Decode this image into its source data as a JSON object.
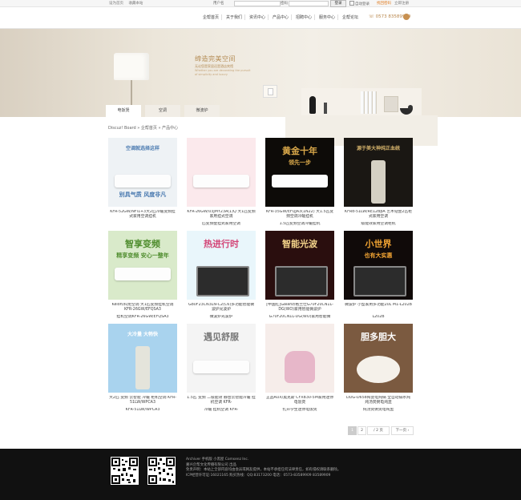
{
  "topbar": {
    "links": [
      "设为首页",
      "收藏本站"
    ],
    "username_label": "用户名",
    "login_button": "登录",
    "auto_login": "自动登录",
    "forgot_password": "找回密码",
    "register": "立即注册",
    "accent": "#e07b1f"
  },
  "nav": {
    "items": [
      "企帮首页",
      "关于我们",
      "资讯中心",
      "产品中心",
      "招聘中心",
      "服务中心",
      "企帮论坛"
    ],
    "phone": "0573 83589909"
  },
  "banner": {
    "title": "缔造完美空间",
    "subtitle": "无论您是家居还是酒店宾馆",
    "subtitle2": "Whether you are decorating the pursuit of simplicity and luxury"
  },
  "tabs": [
    "电饭煲",
    "空调",
    "微波炉"
  ],
  "breadcrumb": "Discuz! Board » 企帮首页 » 产品中心",
  "products": [
    {
      "name1": "KFR-52GW/NFI1+3大2匹冷暖变频挂式家用空调挂机",
      "name2": "",
      "img_text": "空调就选择这样",
      "img_text2": "别具气质 风度非凡",
      "bg": "#eef2f5",
      "fg": "#4a7ab0"
    },
    {
      "name1": "KFR-26GW/03JMY23A(1)Q 大1匹变频家用挂式空调",
      "name2": "匹变频壁挂式家用空调",
      "img_text": "",
      "img_text2": "",
      "bg": "#fbe9ec",
      "fg": "#e05c6a"
    },
    {
      "name1": "KFR-35GW/EFQJA3(1N22) 大1.5匹变频空调冷暖挂机",
      "name2": "1.5匹变频空调冷暖挂机",
      "img_text": "黄金十年",
      "img_text2": "领先一步",
      "bg": "#0d0b08",
      "fg": "#d9a84a"
    },
    {
      "name1": "KFRd-51LW/RE12BpA 艺术钻金2匹柜式家用空调",
      "name2": "级能效家用空调柜机",
      "img_text": "源于美大神纯正血统",
      "img_text2": "",
      "bg": "#1a1713",
      "fg": "#d6b46c"
    },
    {
      "name1": "Kelon/科龙空调 大1匹变频挂机空调 KFR-26GW/EFQSA3",
      "name2": "挂机空调KFR-26GW/EFQSA3",
      "img_text": "智享变频",
      "img_text2": "精享变频 安心一整年",
      "bg": "#d9eaca",
      "fg": "#4f8d2e"
    },
    {
      "name1": "G80F23CN3LN-C2(C6)多功能智能微波炉光波炉",
      "name2": "微波炉光波炉",
      "img_text": "热进行时",
      "img_text2": "",
      "bg": "#e9f6fb",
      "fg": "#d34476"
    },
    {
      "name1": "[中国红]Galanz/格兰仕G70F20CN1L-DG(WO)家用智能微波炉",
      "name2": "G70F20CN1L-DG(WO)家用智能微",
      "img_text": "智能光波",
      "img_text2": "",
      "bg": "#2a0e0e",
      "fg": "#f3d38a"
    },
    {
      "name1": "微波炉 小型家用多功能20L M1-L202B",
      "name2": "L202B",
      "img_text": "小世界",
      "img_text2": "也有大实惠",
      "bg": "#100a09",
      "fg": "#f2a433"
    },
    {
      "name1": "大2匹 变频 云智能 冷暖 柜机空调 KFR-51LW/WPCA3",
      "name2": "KFR-51LW/WPCA3",
      "img_text": "大冷量 大畅快",
      "img_text2": "",
      "bg": "#a9d3ee",
      "fg": "#ffffff"
    },
    {
      "name1": "1.5匹 变频 二级能效 静音云智能冷暖 挂机空调 KFR-",
      "name2": "冷暖 挂机空调 KFR-",
      "img_text": "遇见舒服",
      "img_text2": "",
      "bg": "#f4f4f4",
      "fg": "#777777"
    },
    {
      "name1": "正品AUX/奥克斯 CFXB30-5M家用迷你电饭煲",
      "name2": "扎升学生迷你电饭煲",
      "img_text": "",
      "img_text2": "",
      "bg": "#f6edea",
      "fg": "#c6618a"
    },
    {
      "name1": "DDG-D658陶瓷电炖锅 全自动隔水炖 炖汤煲粥电炖盅",
      "name2": "炖汤煲粥煲电炖盅",
      "img_text": "胆多胆大",
      "img_text2": "",
      "bg": "#7b5a40",
      "fg": "#ffffff"
    }
  ],
  "pagination": {
    "pages": [
      "1",
      "2"
    ],
    "total": "/ 2 页",
    "next": "下一页"
  },
  "footer": {
    "line1": "Archiver 手机版 小黑屋 Comsenz Inc.",
    "line2": "嘉兴企帮文化传播有限公司 出品",
    "line3": "免责声明：本站上全部内容均由会员或网友提供，本站不承担任何法律责任，如有侵权请联系删除。",
    "line4": "ICP经营许可证:16021165 购买热线：QQ:83173200 电话：0573-83589909 83589909"
  }
}
